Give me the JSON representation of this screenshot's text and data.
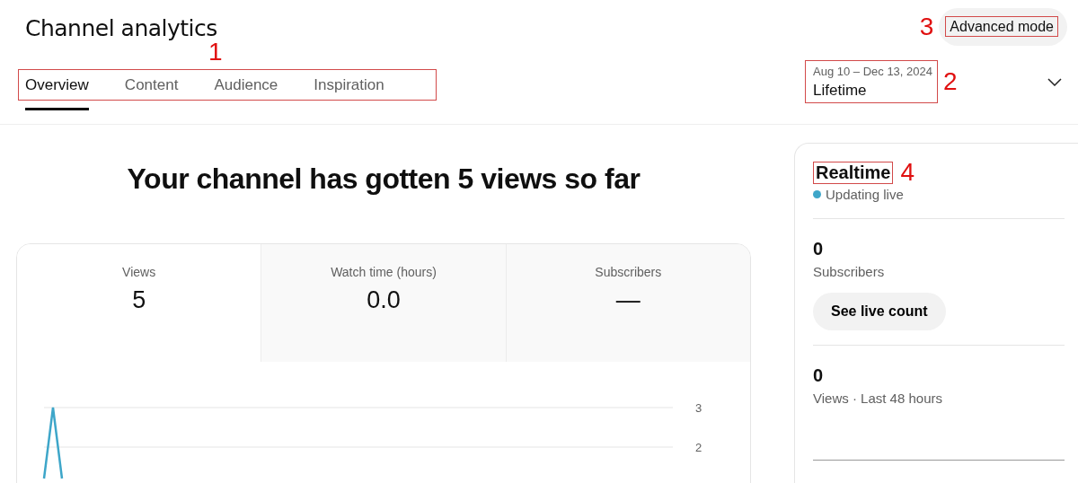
{
  "header": {
    "title": "Channel analytics",
    "advanced_button": "Advanced mode",
    "advanced_callout": "3"
  },
  "tabs_callout": "1",
  "tabs": [
    {
      "label": "Overview",
      "selected": true
    },
    {
      "label": "Content",
      "selected": false
    },
    {
      "label": "Audience",
      "selected": false
    },
    {
      "label": "Inspiration",
      "selected": false
    }
  ],
  "date_range": {
    "range": "Aug 10 – Dec 13, 2024",
    "period": "Lifetime",
    "callout": "2"
  },
  "headline": "Your channel has gotten 5 views so far",
  "metrics": [
    {
      "label": "Views",
      "value": "5",
      "selected": true
    },
    {
      "label": "Watch time (hours)",
      "value": "0.0",
      "selected": false
    },
    {
      "label": "Subscribers",
      "value": "—",
      "selected": false
    }
  ],
  "chart_ticks": [
    "3",
    "2"
  ],
  "realtime": {
    "title": "Realtime",
    "callout": "4",
    "status": "Updating live",
    "stats": [
      {
        "value": "0",
        "label": "Subscribers",
        "button": "See live count"
      },
      {
        "value": "0",
        "label": "Views · Last 48 hours"
      }
    ]
  }
}
